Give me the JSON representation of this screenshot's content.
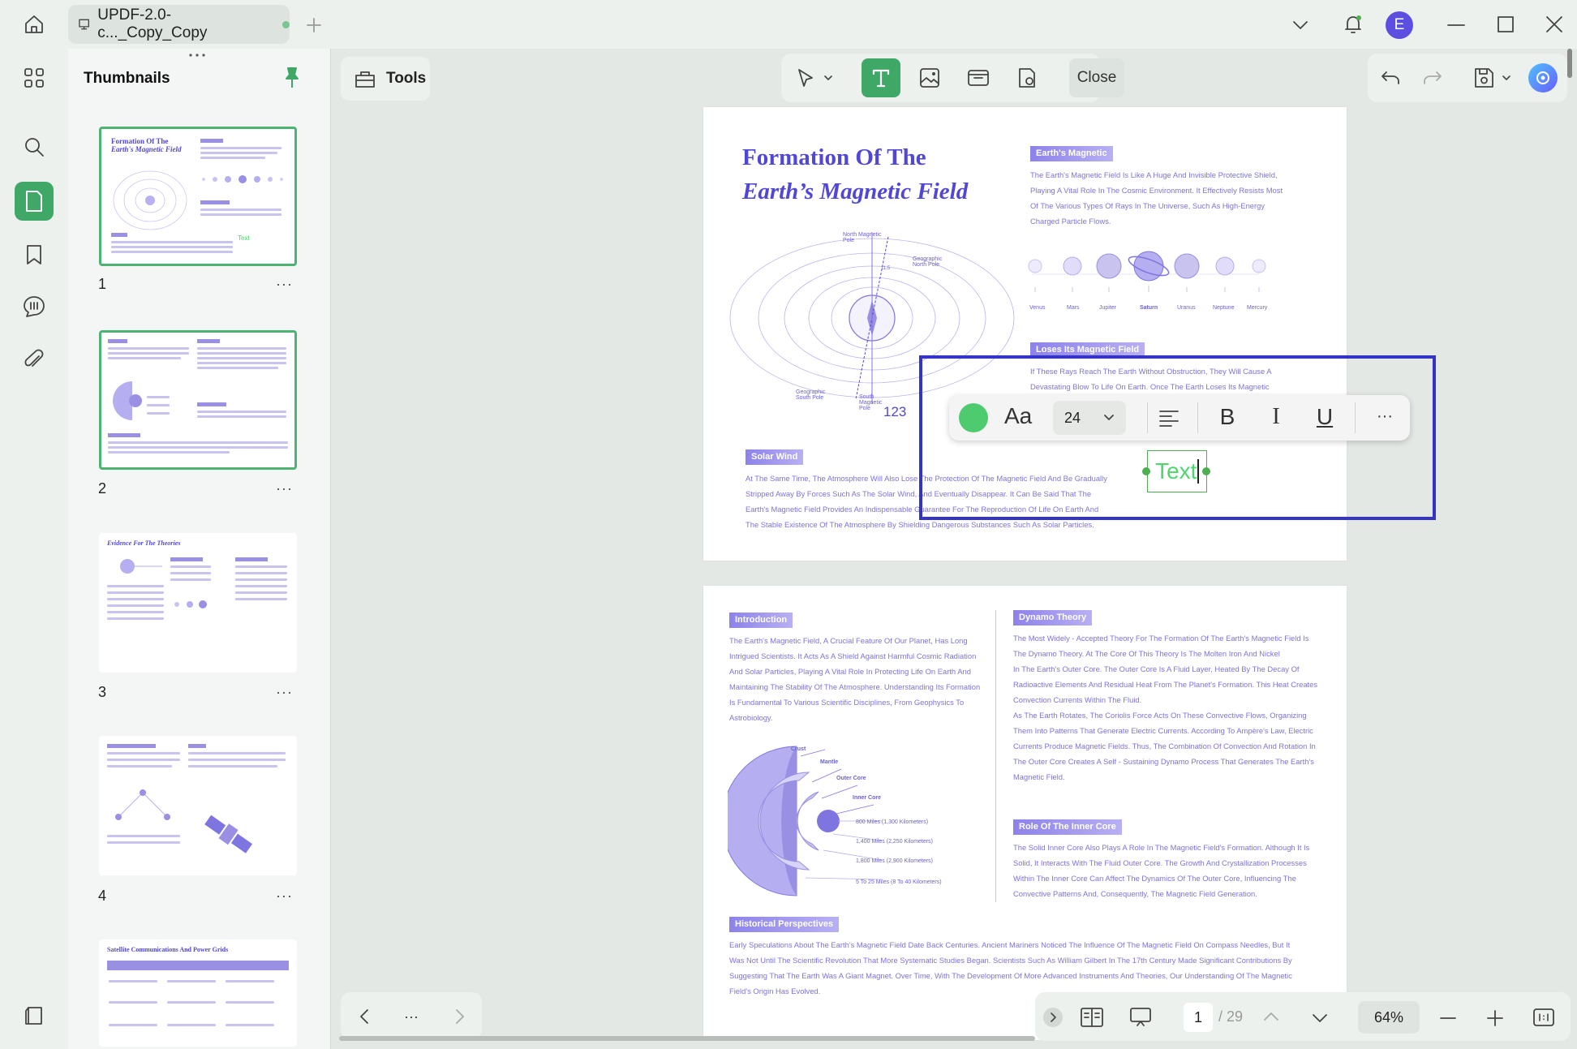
{
  "app": {
    "tab_title": "UPDF-2.0-c..._Copy_Copy",
    "avatar_letter": "E",
    "accent_color": "#3fa866",
    "selection_color": "#3434c7"
  },
  "sidebar": {
    "title": "Thumbnails",
    "pages": [
      {
        "number": "1",
        "more": "···"
      },
      {
        "number": "2",
        "more": "···"
      },
      {
        "number": "3",
        "more": "···"
      },
      {
        "number": "4",
        "more": "···"
      }
    ],
    "thumb3_title": "Evidence For The Theories",
    "thumb5_title": "Satellite Communications And Power Grids"
  },
  "toolbar": {
    "tools_label": "Tools",
    "close_label": "Close"
  },
  "page1": {
    "title_line1": "Formation Of The",
    "title_line2": "Earth’s Magnetic Field",
    "badge_earth": "Earth's Magnetic",
    "earth_text": [
      "The Earth's Magnetic Field Is Like A Huge And Invisible Protective Shield,",
      "Playing A Vital Role In The Cosmic Environment. It Effectively Resists Most",
      "Of The Various Types Of Rays In The Universe, Such As High-Energy",
      "Charged Particle Flows."
    ],
    "planets": [
      "Venus",
      "Mars",
      "Jupiter",
      "Saturn",
      "Uranus",
      "Neptune",
      "Mercury"
    ],
    "badge_loses": "Loses Its Magnetic Field",
    "loses_text": [
      "If These Rays Reach The Earth Without Obstruction, They Will Cause A",
      "Devastating Blow To Life On Earth. Once The Earth Loses Its Magnetic"
    ],
    "diagram_labels": {
      "north": "North Magnetic Pole",
      "geo_north": "Geographic North Pole",
      "geo_south": "Geographic South Pole",
      "south": "South Magnetic Pole",
      "angle": "11.5"
    },
    "number_123": "123",
    "badge_solar": "Solar Wind",
    "solar_text": [
      "At The Same Time, The Atmosphere Will Also Lose The Protection Of The Magnetic Field And Be Gradually",
      "Stripped Away By Forces Such As The Solar Wind, And Eventually Disappear. It Can Be Said That The",
      "Earth's Magnetic Field Provides An Indispensable Guarantee For The Reproduction Of Life On Earth And",
      "The Stable Existence Of The Atmosphere By Shielding Dangerous Substances Such As Solar Particles."
    ]
  },
  "text_toolbar": {
    "font_icon": "Aa",
    "font_size": "24",
    "bold": "B",
    "italic": "I",
    "underline": "U",
    "more": "···",
    "text_color": "#4ecb6e"
  },
  "new_text": "Text",
  "page2": {
    "badge_intro": "Introduction",
    "intro_text": [
      "The Earth's Magnetic Field, A Crucial Feature Of Our Planet, Has Long",
      "Intrigued Scientists. It Acts As A Shield Against Harmful Cosmic Radiation",
      "And Solar Particles, Playing A Vital Role In Protecting Life On Earth And",
      "Maintaining The Stability Of The Atmosphere. Understanding Its Formation",
      "Is Fundamental To Various Scientific Disciplines, From Geophysics To",
      "Astrobiology."
    ],
    "layers": [
      "Crust",
      "Mantle",
      "Outer Core",
      "Inner Core"
    ],
    "distances": [
      "800 Miles (1,300 Kilometers)",
      "1,400 Miles (2,250 Kilometers)",
      "1,800 Miles (2,900 Kilometers)",
      "5 To 25 Miles (8 To 40 Kilometers)"
    ],
    "badge_dynamo": "Dynamo Theory",
    "dynamo_text": [
      "The Most Widely - Accepted Theory For The Formation Of The Earth's Magnetic Field Is",
      "The Dynamo Theory. At The Core Of This Theory Is The Molten Iron And Nickel",
      "In The Earth's Outer Core. The Outer Core Is A Fluid Layer, Heated By The Decay Of",
      "Radioactive Elements And Residual Heat From The Planet's Formation. This Heat Creates",
      "Convection Currents Within The Fluid.",
      "As The Earth Rotates, The Coriolis Force Acts On These Convective Flows, Organizing",
      "Them Into Patterns That Generate Electric Currents. According To Ampère's Law, Electric",
      "Currents Produce Magnetic Fields. Thus, The Combination Of Convection And Rotation In",
      "The Outer Core Creates A Self - Sustaining Dynamo Process That Generates The Earth's",
      "Magnetic Field."
    ],
    "badge_inner": "Role Of The Inner Core",
    "inner_text": [
      "The Solid Inner Core Also Plays A Role In The Magnetic Field's Formation. Although It Is",
      "Solid, It Interacts With The Fluid Outer Core. The Growth And Crystallization Processes",
      "Within The Inner Core Can Affect The Dynamics Of The Outer Core, Influencing The",
      "Convective Patterns And, Consequently, The Magnetic Field Generation."
    ],
    "badge_hist": "Historical Perspectives",
    "hist_text": [
      "Early Speculations About The Earth's Magnetic Field Date Back Centuries. Ancient Mariners Noticed The Influence Of The Magnetic Field On Compass Needles, But It",
      "Was Not Until The Scientific Revolution That More Systematic Studies Began. Scientists Such As William Gilbert In The 17th Century Made Significant Contributions By",
      "Suggesting That The Earth Was A Giant Magnet. Over Time, With The Development Of More Advanced Instruments And Theories, Our Understanding Of The Magnetic",
      "Field's Origin Has Evolved."
    ]
  },
  "footer": {
    "nav_more": "···",
    "current_page": "1",
    "total_pages": "/ 29",
    "zoom": "64%"
  }
}
